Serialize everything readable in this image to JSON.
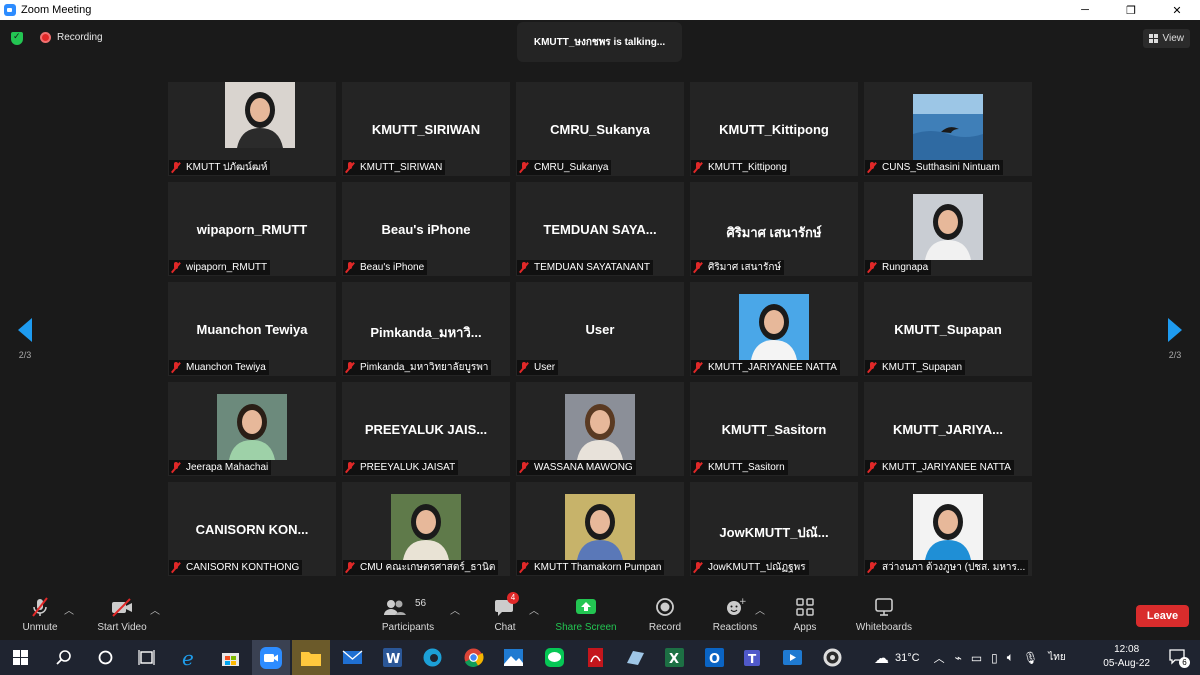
{
  "window": {
    "title": "Zoom Meeting"
  },
  "header": {
    "recording_label": "Recording",
    "talking_indicator": "KMUTT_ษงกชพร is  talking...",
    "view_label": "View"
  },
  "navigation": {
    "page_indicator_left": "2/3",
    "page_indicator_right": "2/3"
  },
  "participants": [
    {
      "big": "",
      "label": "KMUTT ปภัฒน์ฒห์",
      "photo": "woman-dark"
    },
    {
      "big": "KMUTT_SIRIWAN",
      "label": "KMUTT_SIRIWAN"
    },
    {
      "big": "CMRU_Sukanya",
      "label": "CMRU_Sukanya"
    },
    {
      "big": "KMUTT_Kittipong",
      "label": "KMUTT_Kittipong"
    },
    {
      "big": "",
      "label": "CUNS_Sutthasini Nintuam",
      "photo": "sea"
    },
    {
      "big": "wipaporn_RMUTT",
      "label": "wipaporn_RMUTT"
    },
    {
      "big": "Beau's iPhone",
      "label": "Beau's iPhone"
    },
    {
      "big": "TEMDUAN SAYA...",
      "label": "TEMDUAN SAYATANANT"
    },
    {
      "big": "ศิริมาศ เสนารักษ์",
      "label": "ศิริมาศ เสนารักษ์"
    },
    {
      "big": "",
      "label": "Rungnapa",
      "photo": "woman-white"
    },
    {
      "big": "Muanchon Tewiya",
      "label": "Muanchon Tewiya"
    },
    {
      "big": "Pimkanda_มหาวิ...",
      "label": "Pimkanda_มหาวิทยาลัยบูรพา"
    },
    {
      "big": "User",
      "label": "User"
    },
    {
      "big": "",
      "label": "KMUTT_JARIYANEE NATTA",
      "photo": "woman-red"
    },
    {
      "big": "KMUTT_Supapan",
      "label": "KMUTT_Supapan"
    },
    {
      "big": "",
      "label": "Jeerapa Mahachai",
      "photo": "woman-green"
    },
    {
      "big": "PREEYALUK JAIS...",
      "label": "PREEYALUK JAISAT"
    },
    {
      "big": "",
      "label": "WASSANA MAWONG",
      "photo": "woman-smile"
    },
    {
      "big": "KMUTT_Sasitorn",
      "label": "KMUTT_Sasitorn"
    },
    {
      "big": "KMUTT_JARIYA...",
      "label": "KMUTT_JARIYANEE NATTA"
    },
    {
      "big": "CANISORN  KON...",
      "label": "CANISORN KONTHONG"
    },
    {
      "big": "",
      "label": "CMU คณะเกษตรศาสตร์_ธานิต",
      "photo": "man-outdoor"
    },
    {
      "big": "",
      "label": "KMUTT Thamakorn Pumpan",
      "photo": "woman-glasses"
    },
    {
      "big": "JowKMUTT_ปณั...",
      "label": "JowKMUTT_ปณัฏฐพร"
    },
    {
      "big": "",
      "label": "สว่างนภา ด้วงภูษา (ปชส. มหาร...",
      "photo": "woman-blue"
    }
  ],
  "toolbar": {
    "unmute": "Unmute",
    "start_video": "Start Video",
    "participants": "Participants",
    "participant_count": "56",
    "chat": "Chat",
    "chat_badge": "4",
    "share_screen": "Share Screen",
    "record": "Record",
    "reactions": "Reactions",
    "apps": "Apps",
    "whiteboards": "Whiteboards",
    "leave": "Leave"
  },
  "taskbar": {
    "weather": "31°C",
    "language": "ไทย",
    "time": "12:08",
    "date": "05-Aug-22",
    "notification_count": "6"
  },
  "colors": {
    "accent": "#2d8cff",
    "share_green": "#23c552",
    "leave_red": "#d92c2c",
    "muted_red": "#e02828"
  }
}
